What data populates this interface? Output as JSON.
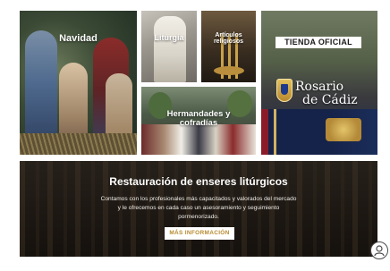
{
  "tiles": {
    "navidad": {
      "label": "Navidad"
    },
    "liturgia": {
      "label": "Liturgia"
    },
    "articulos": {
      "label_line1": "Artículos",
      "label_line2": "religiosos"
    },
    "hermandades": {
      "label_line1": "Hermandades y",
      "label_line2": "cofradías"
    },
    "tienda": {
      "banner": "TIENDA OFICIAL",
      "logo_line1": "Rosario",
      "logo_line2": "de Cádiz"
    }
  },
  "restauracion": {
    "title": "Restauración de enseres litúrgicos",
    "desc_line1": "Contamos con los profesionales más capacitados y valorados del mercado",
    "desc_line2": "y le ofrecemos en cada caso un asesoramiento y seguimiento",
    "desc_line3": "pormenorizado.",
    "button_label": "MÁS INFORMACIÓN"
  },
  "colors": {
    "accent_gold": "#b88a2e",
    "text_white": "#ffffff"
  },
  "icons": {
    "chat_widget": "chat-assistant-icon"
  }
}
